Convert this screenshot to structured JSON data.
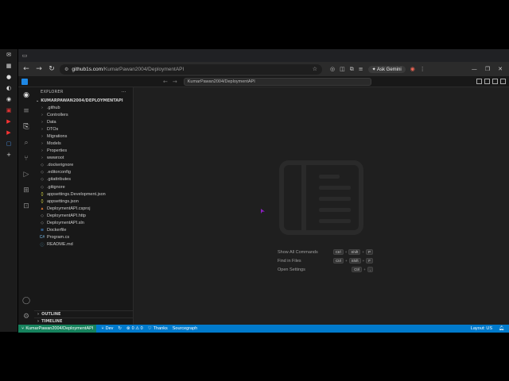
{
  "browser": {
    "url_host": "github1s.com",
    "url_path": "/KumarPawan2004/DeploymentAPI",
    "ask_gemini": "Ask Gemini"
  },
  "vscode": {
    "search_text": "KumarPawan2004/DeploymentAPI",
    "explorer_title": "EXPLORER",
    "root_folder": "KUMARPAWAN2004/DEPLOYMENTAPI",
    "tree": [
      {
        "name": ".github",
        "kind": "folder"
      },
      {
        "name": "Controllers",
        "kind": "folder"
      },
      {
        "name": "Data",
        "kind": "folder"
      },
      {
        "name": "DTOs",
        "kind": "folder"
      },
      {
        "name": "Migrations",
        "kind": "folder"
      },
      {
        "name": "Models",
        "kind": "folder"
      },
      {
        "name": "Properties",
        "kind": "folder"
      },
      {
        "name": "wwwroot",
        "kind": "folder"
      },
      {
        "name": ".dockerignore",
        "kind": "file"
      },
      {
        "name": ".editorconfig",
        "kind": "file"
      },
      {
        "name": ".gitattributes",
        "kind": "file"
      },
      {
        "name": ".gitignore",
        "kind": "file"
      },
      {
        "name": "appsettings.Development.json",
        "kind": "json"
      },
      {
        "name": "appsettings.json",
        "kind": "json"
      },
      {
        "name": "DeploymentAPI.csproj",
        "kind": "proj"
      },
      {
        "name": "DeploymentAPI.http",
        "kind": "file"
      },
      {
        "name": "DeploymentAPI.sln",
        "kind": "file"
      },
      {
        "name": "Dockerfile",
        "kind": "dock"
      },
      {
        "name": "Program.cs",
        "kind": "cs"
      },
      {
        "name": "README.md",
        "kind": "md"
      }
    ],
    "outline": "OUTLINE",
    "timeline": "TIMELINE",
    "shortcuts": [
      {
        "label": "Show All Commands",
        "keys": [
          "Ctrl",
          "Shift",
          "P"
        ]
      },
      {
        "label": "Find in Files",
        "keys": [
          "Ctrl",
          "Shift",
          "F"
        ]
      },
      {
        "label": "Open Settings",
        "keys": [
          "Ctrl",
          ","
        ]
      }
    ],
    "status": {
      "remote": "KumarPawan2004/DeploymentAPI",
      "branch": "Dev",
      "problems": "0 ⚠ 0",
      "thanks": "Thanks",
      "sourcegraph": "Sourcegraph",
      "layout": "Layout: US"
    }
  }
}
